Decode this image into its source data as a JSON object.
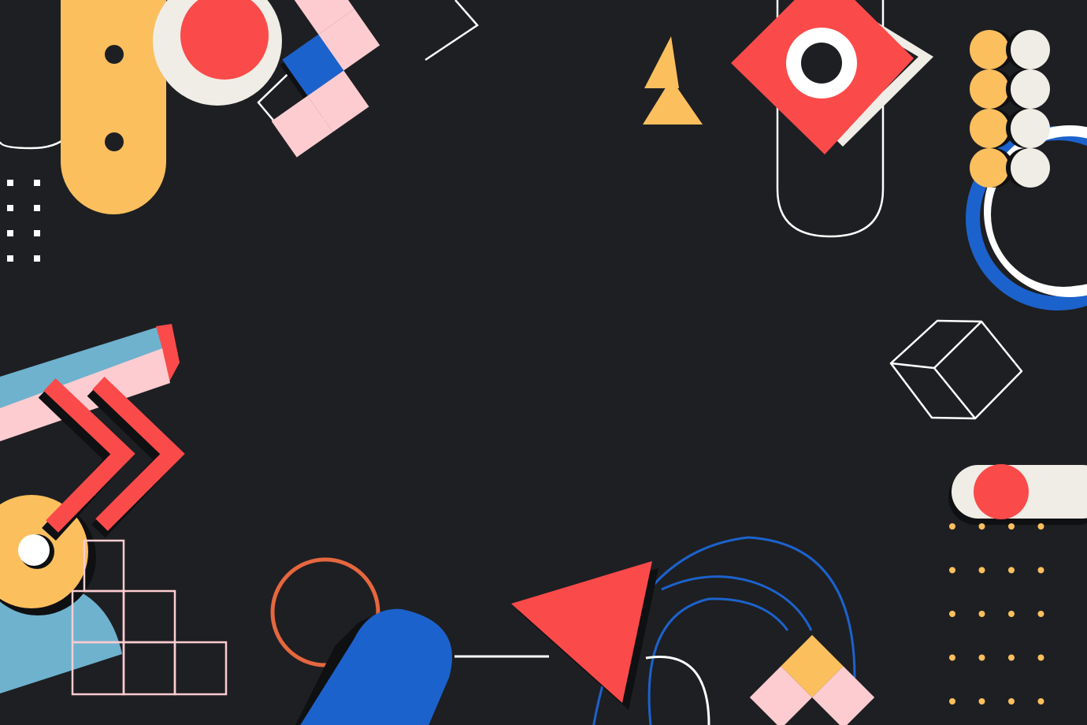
{
  "colors": {
    "background": "#1e1f22",
    "yellow": "#fbbf5e",
    "red": "#fb4a4a",
    "blue": "#1c62cc",
    "pink": "#fcccd0",
    "cream": "#efede6",
    "light_blue": "#6eb2ce",
    "orange": "#e6673f",
    "white": "#ffffff",
    "shadow": "#0f1012"
  }
}
